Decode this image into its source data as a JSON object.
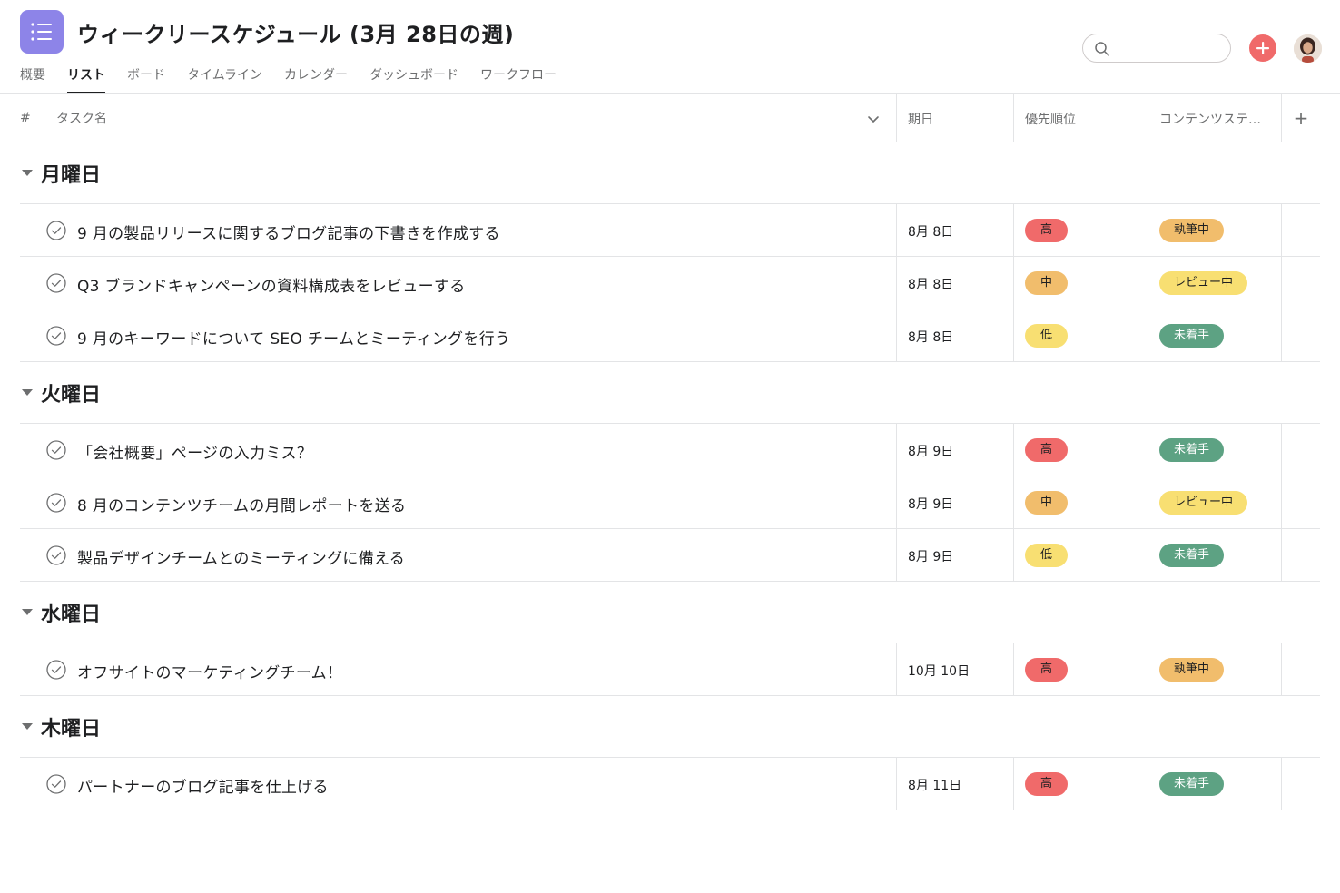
{
  "header": {
    "title": "ウィークリースケジュール (3月 28日の週)",
    "tabs": [
      "概要",
      "リスト",
      "ボード",
      "タイムライン",
      "カレンダー",
      "ダッシュボード",
      "ワークフロー"
    ],
    "active_tab": "リスト",
    "search": {
      "value": "",
      "placeholder": ""
    }
  },
  "columns": {
    "hash": "#",
    "name": "タスク名",
    "due": "期日",
    "priority": "優先順位",
    "status": "コンテンツステ…",
    "add": "+"
  },
  "colors": {
    "brand_icon": "#8d84e8",
    "add_button": "#f06a6a",
    "priority_high": "#f06a6a",
    "priority_medium": "#f1bd6c",
    "priority_low": "#f8df72",
    "status_writing": "#f1bd6c",
    "status_review": "#f8df72",
    "status_not_started": "#5da283"
  },
  "sections": [
    {
      "title": "月曜日",
      "tasks": [
        {
          "name": "9 月の製品リリースに関するブログ記事の下書きを作成する",
          "due": "8月 8日",
          "priority": "高",
          "status": "執筆中"
        },
        {
          "name": "Q3 ブランドキャンペーンの資料構成表をレビューする",
          "due": "8月 8日",
          "priority": "中",
          "status": "レビュー中"
        },
        {
          "name": "9 月のキーワードについて SEO チームとミーティングを行う",
          "due": "8月 8日",
          "priority": "低",
          "status": "未着手"
        }
      ]
    },
    {
      "title": "火曜日",
      "tasks": [
        {
          "name": "「会社概要」ページの入力ミス？",
          "due": "8月 9日",
          "priority": "高",
          "status": "未着手"
        },
        {
          "name": "8 月のコンテンツチームの月間レポートを送る",
          "due": "8月 9日",
          "priority": "中",
          "status": "レビュー中"
        },
        {
          "name": "製品デザインチームとのミーティングに備える",
          "due": "8月 9日",
          "priority": "低",
          "status": "未着手"
        }
      ]
    },
    {
      "title": "水曜日",
      "tasks": [
        {
          "name": "オフサイトのマーケティングチーム！",
          "due": "10月 10日",
          "priority": "高",
          "status": "執筆中"
        }
      ]
    },
    {
      "title": "木曜日",
      "tasks": [
        {
          "name": "パートナーのブログ記事を仕上げる",
          "due": "8月 11日",
          "priority": "高",
          "status": "未着手"
        }
      ]
    }
  ]
}
